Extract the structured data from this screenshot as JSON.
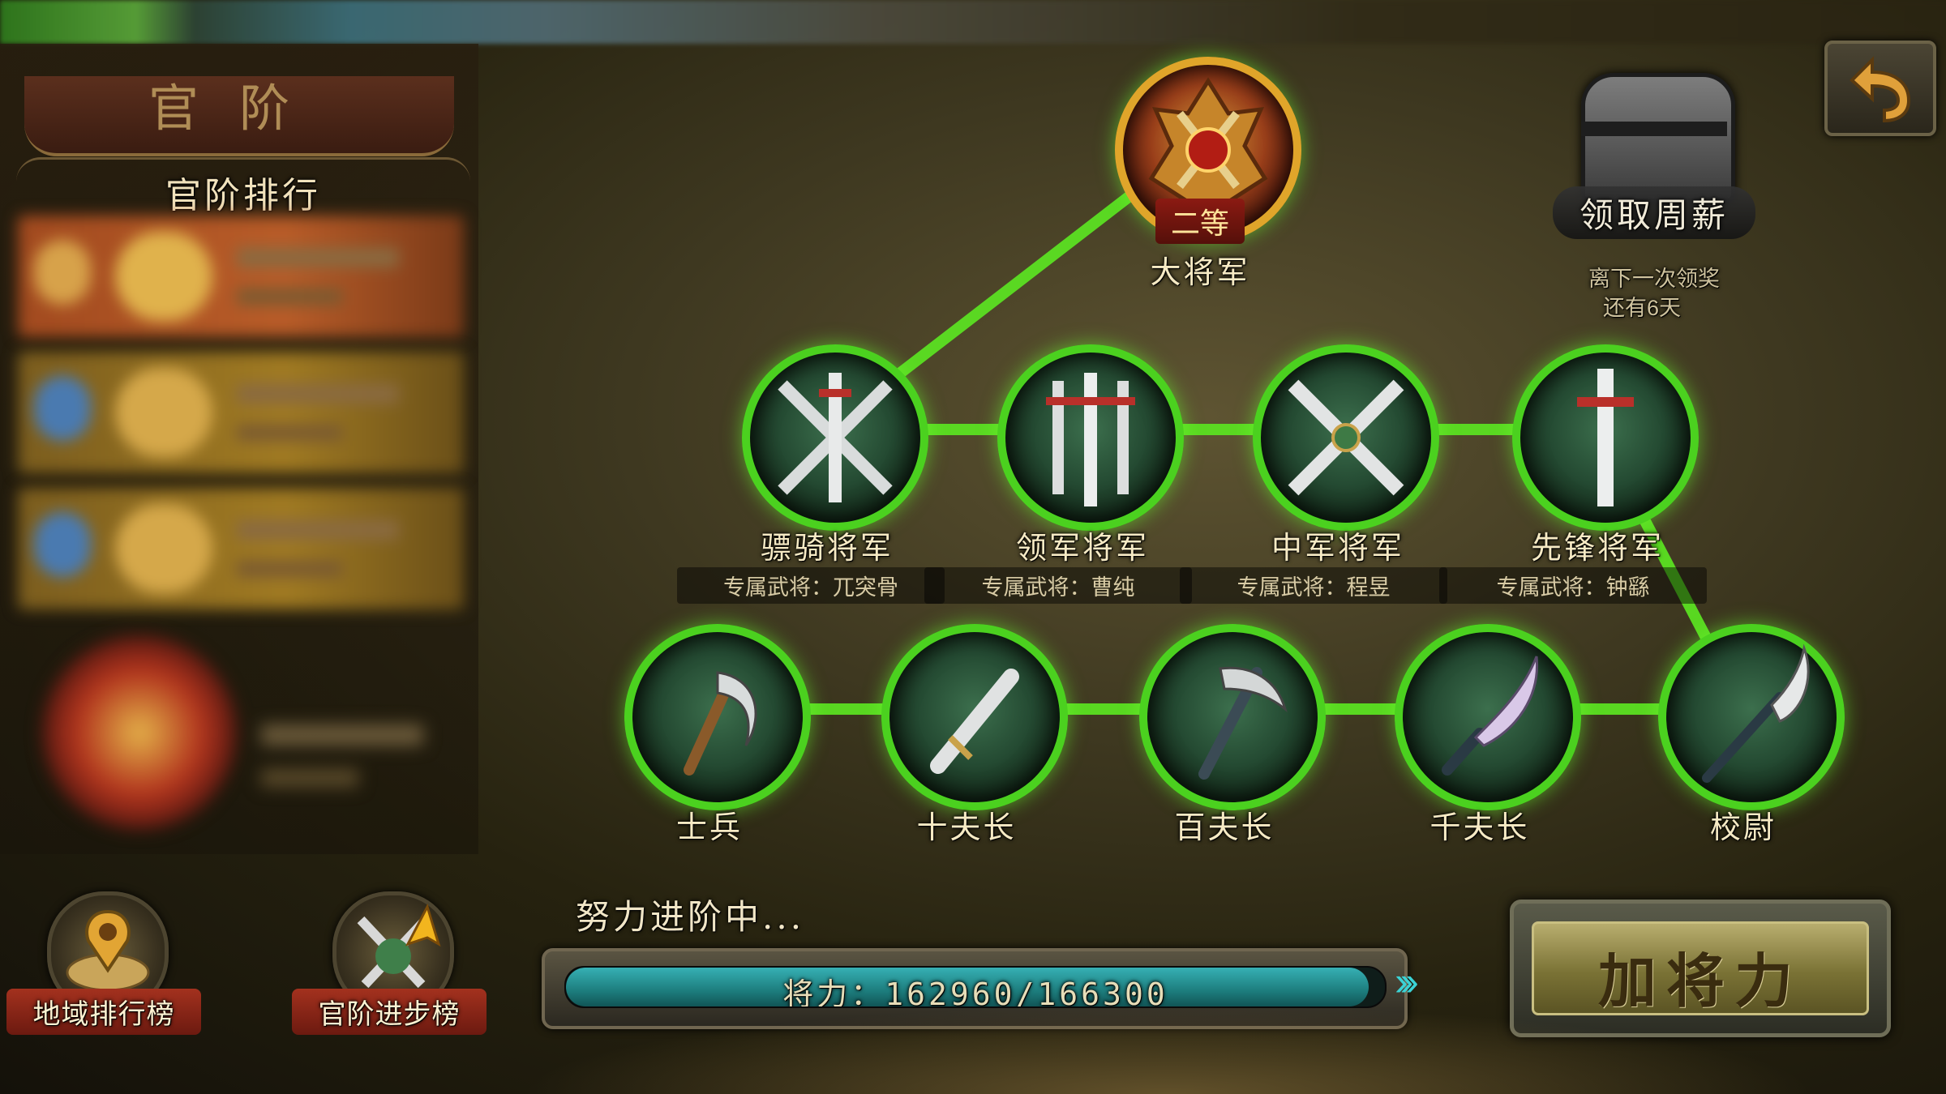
{
  "left_panel": {
    "title": "官阶",
    "ranking_header": "官阶排行"
  },
  "bottom_buttons": {
    "region_rank": "地域排行榜",
    "progress_rank": "官阶进步榜"
  },
  "top_rank": {
    "name": "大将军",
    "grade": "二等"
  },
  "generals_row": [
    {
      "name": "骠骑将军",
      "exclusive": "专属武将：兀突骨"
    },
    {
      "name": "领军将军",
      "exclusive": "专属武将：曹纯"
    },
    {
      "name": "中军将军",
      "exclusive": "专属武将：程昱"
    },
    {
      "name": "先锋将军",
      "exclusive": "专属武将：钟繇"
    }
  ],
  "soldiers_row": [
    {
      "name": "士兵"
    },
    {
      "name": "十夫长"
    },
    {
      "name": "百夫长"
    },
    {
      "name": "千夫长"
    },
    {
      "name": "校尉"
    }
  ],
  "weekly_salary": {
    "label": "领取周薪",
    "line1": "离下一次领奖",
    "line2": "还有6天"
  },
  "progress": {
    "caption": "努力进阶中...",
    "text": "将力：162960/166300",
    "current": 162960,
    "max": 166300
  },
  "add_power_button": "加将力",
  "colors": {
    "path_green": "#4bd11f",
    "progress_teal": "#2a9ea2",
    "button_gold": "#b8ad6e"
  }
}
